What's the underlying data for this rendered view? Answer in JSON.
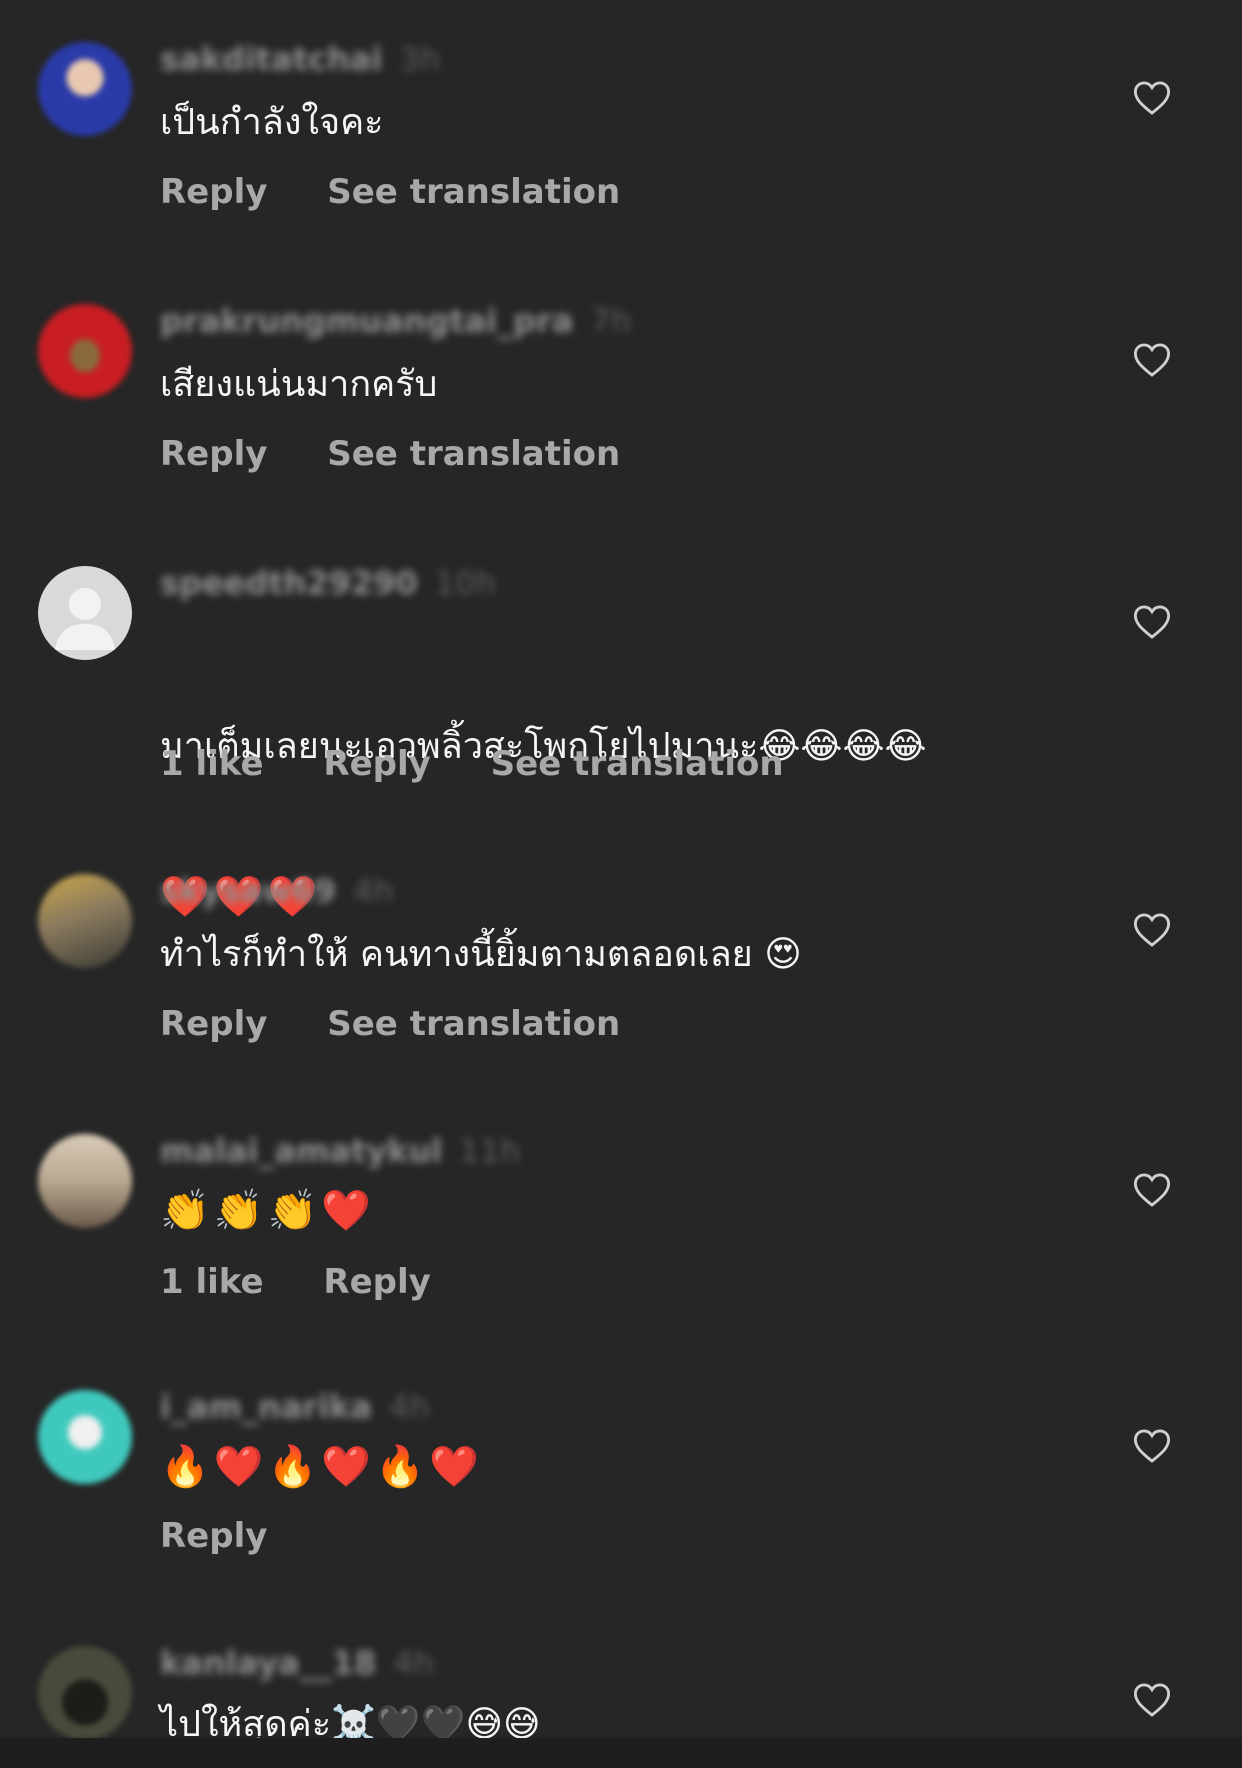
{
  "comments": [
    {
      "username": "sakditatchai",
      "time": "3h",
      "text": "เป็นกำลังใจคะ",
      "text2": "",
      "likes": "",
      "reply": "Reply",
      "translate": "See translation",
      "avatar_color": "#2a3aa8",
      "avatar_icon": "profile-photo"
    },
    {
      "username": "prakrungmuangtai_pra",
      "time": "7h",
      "text": "เสียงแน่นมากครับ",
      "text2": "",
      "likes": "",
      "reply": "Reply",
      "translate": "See translation",
      "avatar_color": "#c81e23",
      "avatar_icon": "profile-photo"
    },
    {
      "username": "speedth29290",
      "time": "10h",
      "text": "มาเต็มเลยนะเอวพลิ้วสะโพกโยไปมานะ😂😂😂😂",
      "text2": "❤️❤️❤️",
      "likes": "1 like",
      "reply": "Reply",
      "translate": "See translation",
      "avatar_color": "#d9d9d9",
      "avatar_icon": "default-avatar-icon"
    },
    {
      "username": "skysaw69",
      "time": "4h",
      "text": "ทำไรก็ทำให้ คนทางนี้ยิ้มตามตลอดเลย 😍",
      "text2": "",
      "likes": "",
      "reply": "Reply",
      "translate": "See translation",
      "avatar_color": "#8a7a5e",
      "avatar_icon": "profile-photo"
    },
    {
      "username": "malai_amatykul",
      "time": "11h",
      "text": "👏👏👏❤️",
      "text2": "",
      "likes": "1 like",
      "reply": "Reply",
      "translate": "",
      "avatar_color": "#b8a890",
      "avatar_icon": "profile-photo"
    },
    {
      "username": "i_am_narika",
      "time": "4h",
      "text": "🔥❤️🔥❤️🔥❤️",
      "text2": "",
      "likes": "",
      "reply": "Reply",
      "translate": "",
      "avatar_color": "#3fc9bd",
      "avatar_icon": "profile-photo"
    },
    {
      "username": "kanlaya__18",
      "time": "4h",
      "text": "ไปให้สุดค่ะ☠️🖤🖤😅😅",
      "text2": "",
      "likes": "",
      "reply": "",
      "translate": "",
      "avatar_color": "#4a4a3c",
      "avatar_icon": "profile-photo"
    }
  ],
  "colors": {
    "background": "#262626",
    "secondary_text": "#a8a8a8",
    "primary_text": "#f5f5f5"
  }
}
